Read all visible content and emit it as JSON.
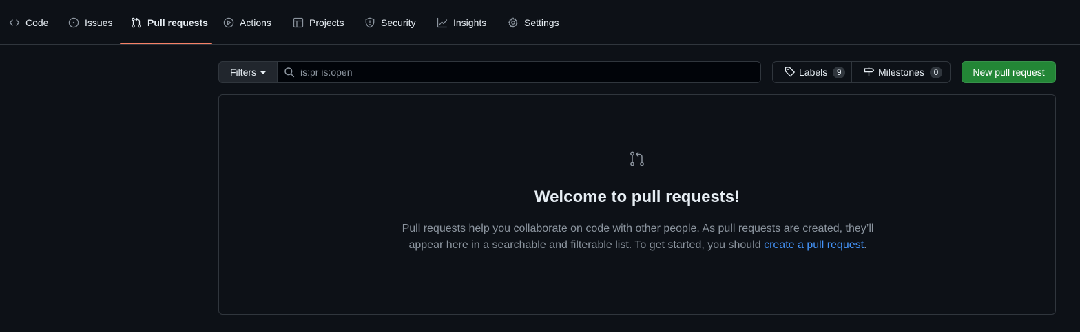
{
  "tabs": [
    {
      "label": "Code",
      "icon": "code-icon"
    },
    {
      "label": "Issues",
      "icon": "issue-opened-icon"
    },
    {
      "label": "Pull requests",
      "icon": "git-pull-request-icon",
      "selected": true
    },
    {
      "label": "Actions",
      "icon": "play-icon"
    },
    {
      "label": "Projects",
      "icon": "table-icon"
    },
    {
      "label": "Security",
      "icon": "shield-icon"
    },
    {
      "label": "Insights",
      "icon": "graph-icon"
    },
    {
      "label": "Settings",
      "icon": "gear-icon"
    }
  ],
  "toolbar": {
    "filters_label": "Filters",
    "search_value": "is:pr is:open",
    "labels_label": "Labels",
    "labels_count": "9",
    "milestones_label": "Milestones",
    "milestones_count": "0",
    "new_pr_label": "New pull request"
  },
  "blankslate": {
    "icon": "git-pull-request-icon",
    "title": "Welcome to pull requests!",
    "text_before_link": "Pull requests help you collaborate on code with other people. As pull requests are created, they’ll appear here in a searchable and filterable list. To get started, you should ",
    "link_text": "create a pull request",
    "text_after_link": "."
  },
  "colors": {
    "background": "#0d1117",
    "border": "#30363d",
    "accent_underline": "#f78166",
    "primary_button": "#238636",
    "link": "#4493f8",
    "muted_text": "#8b949e"
  }
}
